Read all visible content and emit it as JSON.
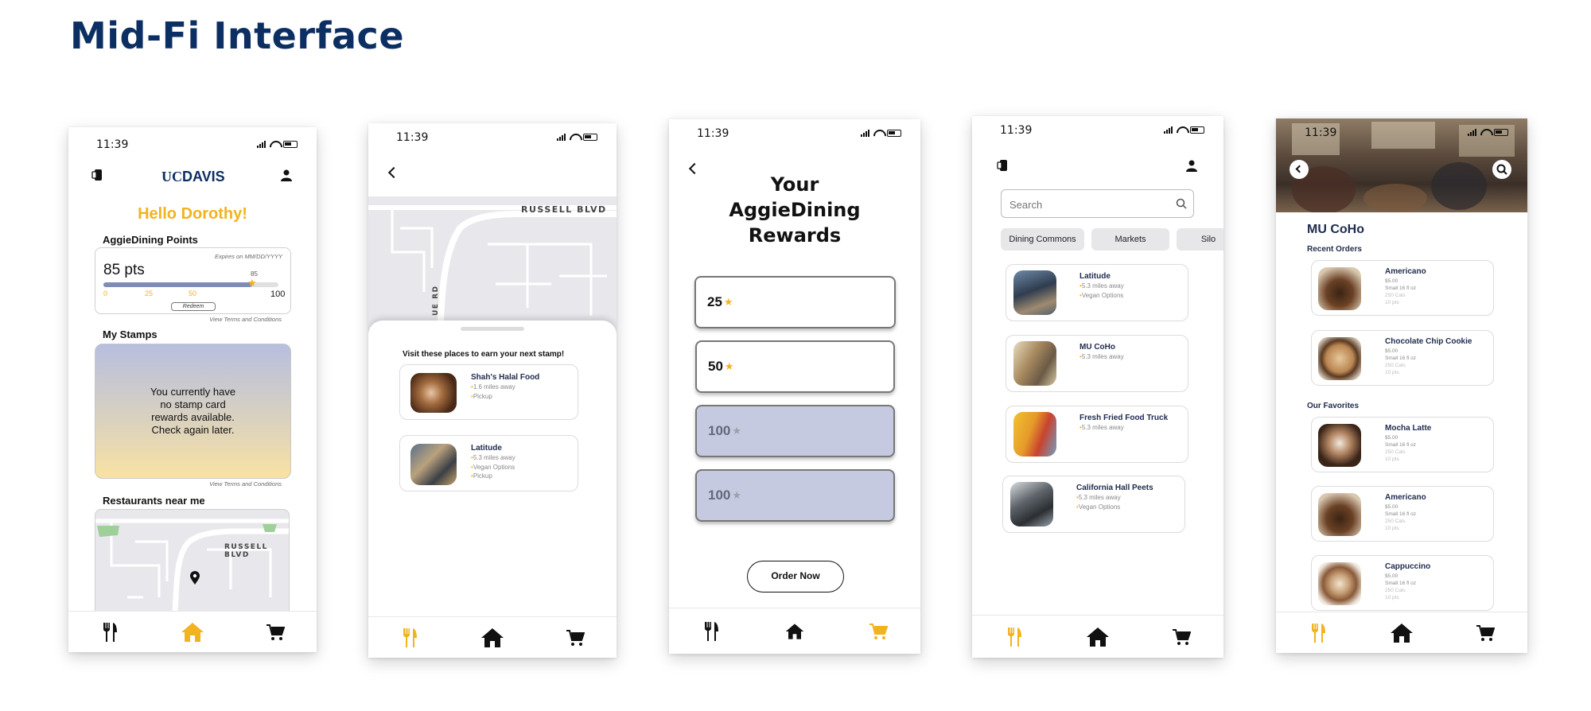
{
  "page_title": "Mid-Fi Interface",
  "status_time": "11:39",
  "colors": {
    "navy": "#0c2f63",
    "gold": "#f1b320",
    "lavender": "#c5cae0"
  },
  "screen1": {
    "logo_uc": "UC",
    "logo_davis": "DAVIS",
    "greeting": "Hello Dorothy!",
    "points_title": "AggieDining Points",
    "expires": "Expires on MM/DD/YYYY",
    "points_value": "85 pts",
    "progress_fraction": 0.85,
    "progress_marker": "85",
    "scale": [
      "0",
      "25",
      "50",
      "100"
    ],
    "redeem": "Redeem",
    "terms": "View Terms and Conditions",
    "stamps_title": "My Stamps",
    "stamps_message": "You currently have no stamp card rewards available. Check again later.",
    "terms2": "View Terms and Conditions",
    "near_title": "Restaurants near me",
    "street": "RUSSELL BLVD",
    "nav_icons": [
      "fork-knife-icon",
      "home-icon",
      "cart-icon"
    ],
    "nav_active": "home"
  },
  "screen2": {
    "street_top": "RUSSELL BLVD",
    "street_side": "UE RD",
    "sheet_title": "Visit these places to earn your next stamp!",
    "places": [
      {
        "name": "Shah's Halal Food",
        "details": [
          "1.6 miles away",
          "Pickup"
        ]
      },
      {
        "name": "Latitude",
        "details": [
          "5.3 miles away",
          "Vegan Options",
          "Pickup"
        ]
      }
    ],
    "nav_active": "dining"
  },
  "screen3": {
    "title": "Your AggieDining Rewards",
    "rewards": [
      {
        "value": "25",
        "locked": false
      },
      {
        "value": "50",
        "locked": false
      },
      {
        "value": "100",
        "locked": true
      },
      {
        "value": "100",
        "locked": true
      }
    ],
    "order_button": "Order Now",
    "nav_active": "cart"
  },
  "screen4": {
    "search_placeholder": "Search",
    "chips": [
      "Dining Commons",
      "Markets",
      "Silo"
    ],
    "restaurants": [
      {
        "name": "Latitude",
        "details": [
          "5.3 miles away",
          "Vegan Options"
        ]
      },
      {
        "name": "MU CoHo",
        "details": [
          "5.3 miles away"
        ]
      },
      {
        "name": "Fresh Fried Food Truck",
        "details": [
          "5.3 miles away"
        ]
      },
      {
        "name": "California Hall Peets",
        "details": [
          "5.3 miles away",
          "Vegan Options"
        ]
      }
    ],
    "nav_active": "dining"
  },
  "screen5": {
    "title": "MU CoHo",
    "recent_title": "Recent Orders",
    "favorites_title": "Our Favorites",
    "recent": [
      {
        "name": "Americano",
        "price": "$5.00",
        "size": "Small 16 fl oz",
        "cal": "250 Cals",
        "pts": "10 pts"
      },
      {
        "name": "Chocolate Chip Cookie",
        "price": "$5.00",
        "size": "Small 16 fl oz",
        "cal": "250 Cals",
        "pts": "10 pts"
      }
    ],
    "favorites": [
      {
        "name": "Mocha Latte",
        "price": "$5.00",
        "size": "Small 16 fl oz",
        "cal": "250 Cals",
        "pts": "10 pts"
      },
      {
        "name": "Americano",
        "price": "$5.00",
        "size": "Small 16 fl oz",
        "cal": "250 Cals",
        "pts": "10 pts"
      },
      {
        "name": "Cappuccino",
        "price": "$5.00",
        "size": "Small 16 fl oz",
        "cal": "250 Cals",
        "pts": "10 pts"
      }
    ],
    "nav_active": "dining"
  }
}
